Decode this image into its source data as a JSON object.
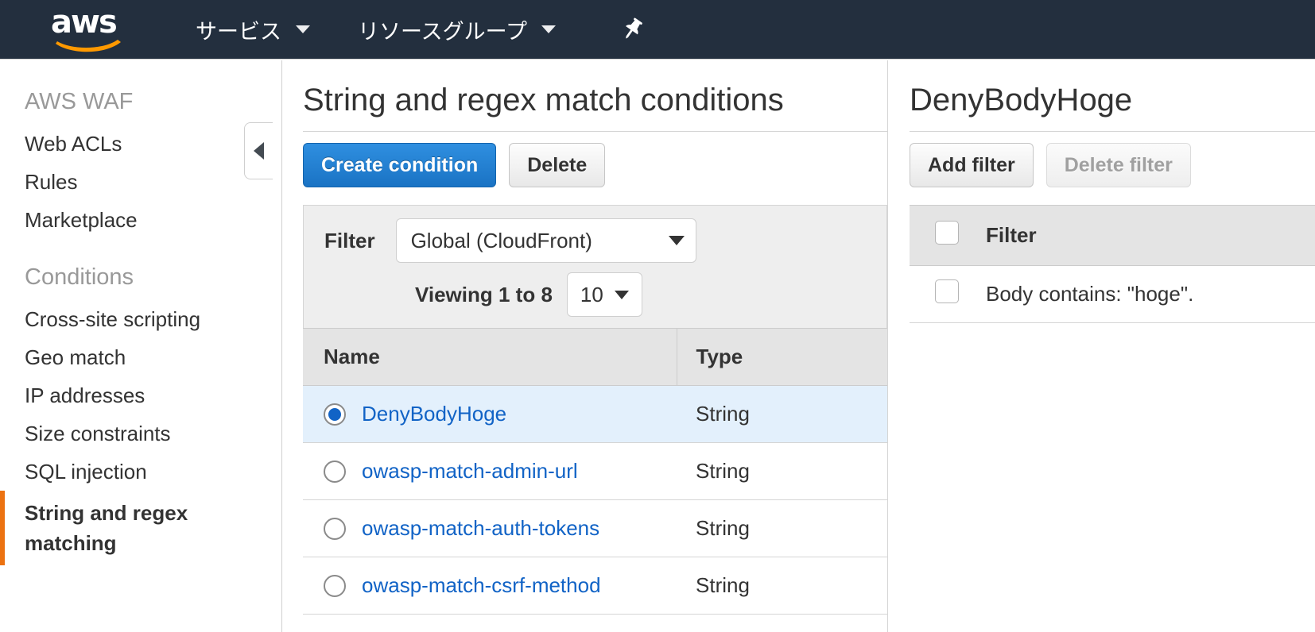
{
  "navbar": {
    "logo_text": "aws",
    "logo_icon": "aws-smile-logo",
    "services_label": "サービス",
    "resource_groups_label": "リソースグループ",
    "pin_icon": "pin-icon"
  },
  "sidebar": {
    "section_waf": "AWS WAF",
    "waf_items": [
      {
        "label": "Web ACLs"
      },
      {
        "label": "Rules"
      },
      {
        "label": "Marketplace"
      }
    ],
    "section_conditions": "Conditions",
    "condition_items": [
      {
        "label": "Cross-site scripting",
        "active": false
      },
      {
        "label": "Geo match",
        "active": false
      },
      {
        "label": "IP addresses",
        "active": false
      },
      {
        "label": "Size constraints",
        "active": false
      },
      {
        "label": "SQL injection",
        "active": false
      },
      {
        "label": "String and regex matching",
        "active": true
      }
    ],
    "collapse_icon": "chevron-left-icon",
    "active_accent_color": "#ec7211"
  },
  "main": {
    "title": "String and regex match conditions",
    "create_button": "Create condition",
    "delete_button": "Delete",
    "filter_label": "Filter",
    "filter_value": "Global (CloudFront)",
    "viewing_text": "Viewing 1 to 8",
    "page_size": "10",
    "columns": {
      "name": "Name",
      "type": "Type"
    },
    "rows": [
      {
        "name": "DenyBodyHoge",
        "type": "String",
        "selected": true
      },
      {
        "name": "owasp-match-admin-url",
        "type": "String",
        "selected": false
      },
      {
        "name": "owasp-match-auth-tokens",
        "type": "String",
        "selected": false
      },
      {
        "name": "owasp-match-csrf-method",
        "type": "String",
        "selected": false
      }
    ]
  },
  "detail": {
    "title": "DenyBodyHoge",
    "add_filter_button": "Add filter",
    "delete_filter_button": "Delete filter",
    "column_filter": "Filter",
    "rows": [
      {
        "text": "Body contains: \"hoge\".",
        "checked": false
      }
    ]
  }
}
